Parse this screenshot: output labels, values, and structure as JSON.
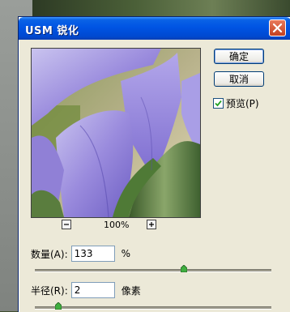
{
  "dialog": {
    "title": "USM 锐化",
    "buttons": {
      "ok": "确定",
      "cancel": "取消"
    },
    "preview_checkbox": {
      "label": "预览(P)",
      "checked": true
    },
    "zoom": {
      "level": "100%"
    },
    "amount": {
      "label": "数量(A):",
      "value": "133",
      "unit": "%",
      "slider_fraction": 0.63
    },
    "radius": {
      "label": "半径(R):",
      "value": "2",
      "unit": "像素",
      "slider_fraction": 0.1
    }
  }
}
